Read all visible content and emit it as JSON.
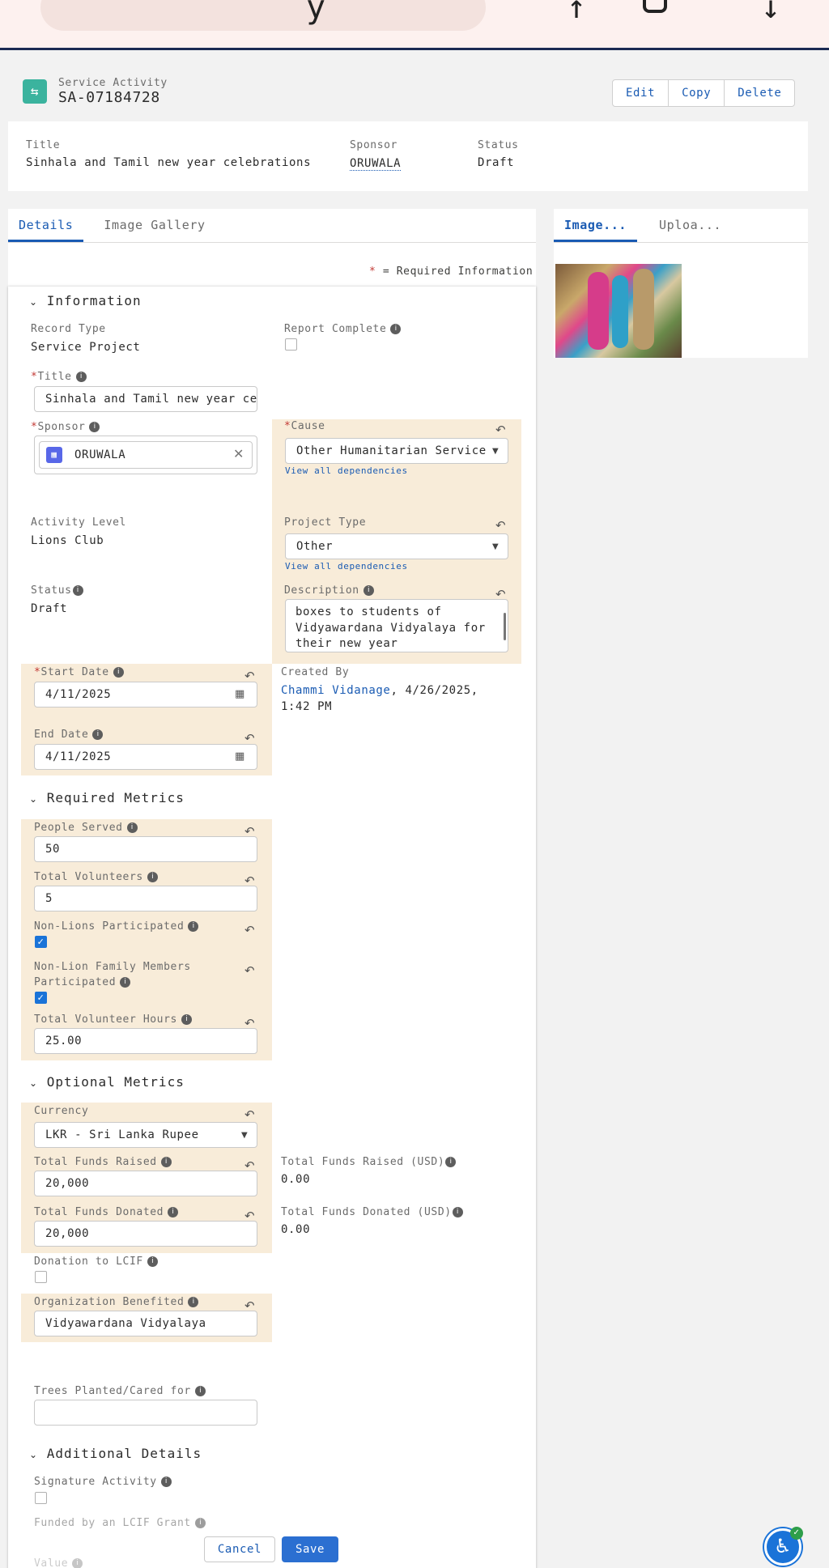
{
  "header": {
    "object_label": "Service Activity",
    "record_name": "SA-07184728",
    "actions": [
      "Edit",
      "Copy",
      "Delete"
    ]
  },
  "highlights": {
    "title_label": "Title",
    "title_value": "Sinhala and Tamil new year celebrations",
    "sponsor_label": "Sponsor",
    "sponsor_value": "ORUWALA",
    "status_label": "Status",
    "status_value": "Draft"
  },
  "tabs": {
    "details": "Details",
    "gallery": "Image Gallery"
  },
  "side_tabs": {
    "images": "Image...",
    "upload": "Uploa..."
  },
  "required_note": "= Required Information",
  "required_star": "*",
  "info": {
    "section": "Information",
    "record_type_label": "Record Type",
    "record_type_value": "Service Project",
    "report_complete_label": "Report Complete",
    "title_label": "Title",
    "title_value": "Sinhala and Tamil new year ce",
    "sponsor_label": "Sponsor",
    "sponsor_value": "ORUWALA",
    "cause_label": "Cause",
    "cause_value": "Other Humanitarian Service",
    "view_dependencies": "View all dependencies",
    "activity_level_label": "Activity Level",
    "activity_level_value": "Lions Club",
    "project_type_label": "Project Type",
    "project_type_value": "Other",
    "status_label": "Status",
    "status_value": "Draft",
    "description_label": "Description",
    "description_lines": [
      "boxes to students of",
      "Vidyawardana Vidyalaya for",
      "their new year celebrations."
    ],
    "start_date_label": "Start Date",
    "start_date_value": "4/11/2025",
    "end_date_label": "End Date",
    "end_date_value": "4/11/2025",
    "created_by_label": "Created By",
    "created_by_name": "Chammi Vidanage",
    "created_by_date": ", 4/26/2025,",
    "created_by_time": "1:42 PM"
  },
  "metrics": {
    "section": "Required Metrics",
    "people_served_label": "People Served",
    "people_served_value": "50",
    "total_volunteers_label": "Total Volunteers",
    "total_volunteers_value": "5",
    "non_lions_label": "Non-Lions Participated",
    "non_lions_checked": true,
    "family_label_1": "Non-Lion Family Members",
    "family_label_2": "Participated",
    "family_checked": true,
    "hours_label": "Total Volunteer Hours",
    "hours_value": "25.00"
  },
  "optional": {
    "section": "Optional Metrics",
    "currency_label": "Currency",
    "currency_value": "LKR - Sri Lanka Rupee",
    "funds_raised_label": "Total Funds Raised",
    "funds_raised_value": "20,000",
    "funds_raised_usd_label": "Total Funds Raised (USD)",
    "funds_raised_usd_value": "0.00",
    "funds_donated_label": "Total Funds Donated",
    "funds_donated_value": "20,000",
    "funds_donated_usd_label": "Total Funds Donated (USD)",
    "funds_donated_usd_value": "0.00",
    "lcif_label": "Donation to LCIF",
    "org_label": "Organization Benefited",
    "org_value": "Vidyawardana Vidyalaya",
    "trees_label": "Trees Planted/Cared for",
    "trees_value": ""
  },
  "additional": {
    "section": "Additional Details",
    "signature_label": "Signature Activity",
    "funded_label": "Funded by an LCIF Grant",
    "values_label": "Value"
  },
  "footer": {
    "cancel": "Cancel",
    "save": "Save"
  },
  "icons": [
    "handshake-icon",
    "info-icon",
    "undo-icon",
    "calendar-icon",
    "account-icon",
    "close-icon",
    "chevron-down-icon",
    "accessibility-icon"
  ],
  "colors": {
    "brand": "#1a5bb3",
    "save": "#2b6fd1",
    "highlight": "#f8ecd9",
    "header_icon": "#3bb39e",
    "accessibility": "#1a73d8"
  }
}
